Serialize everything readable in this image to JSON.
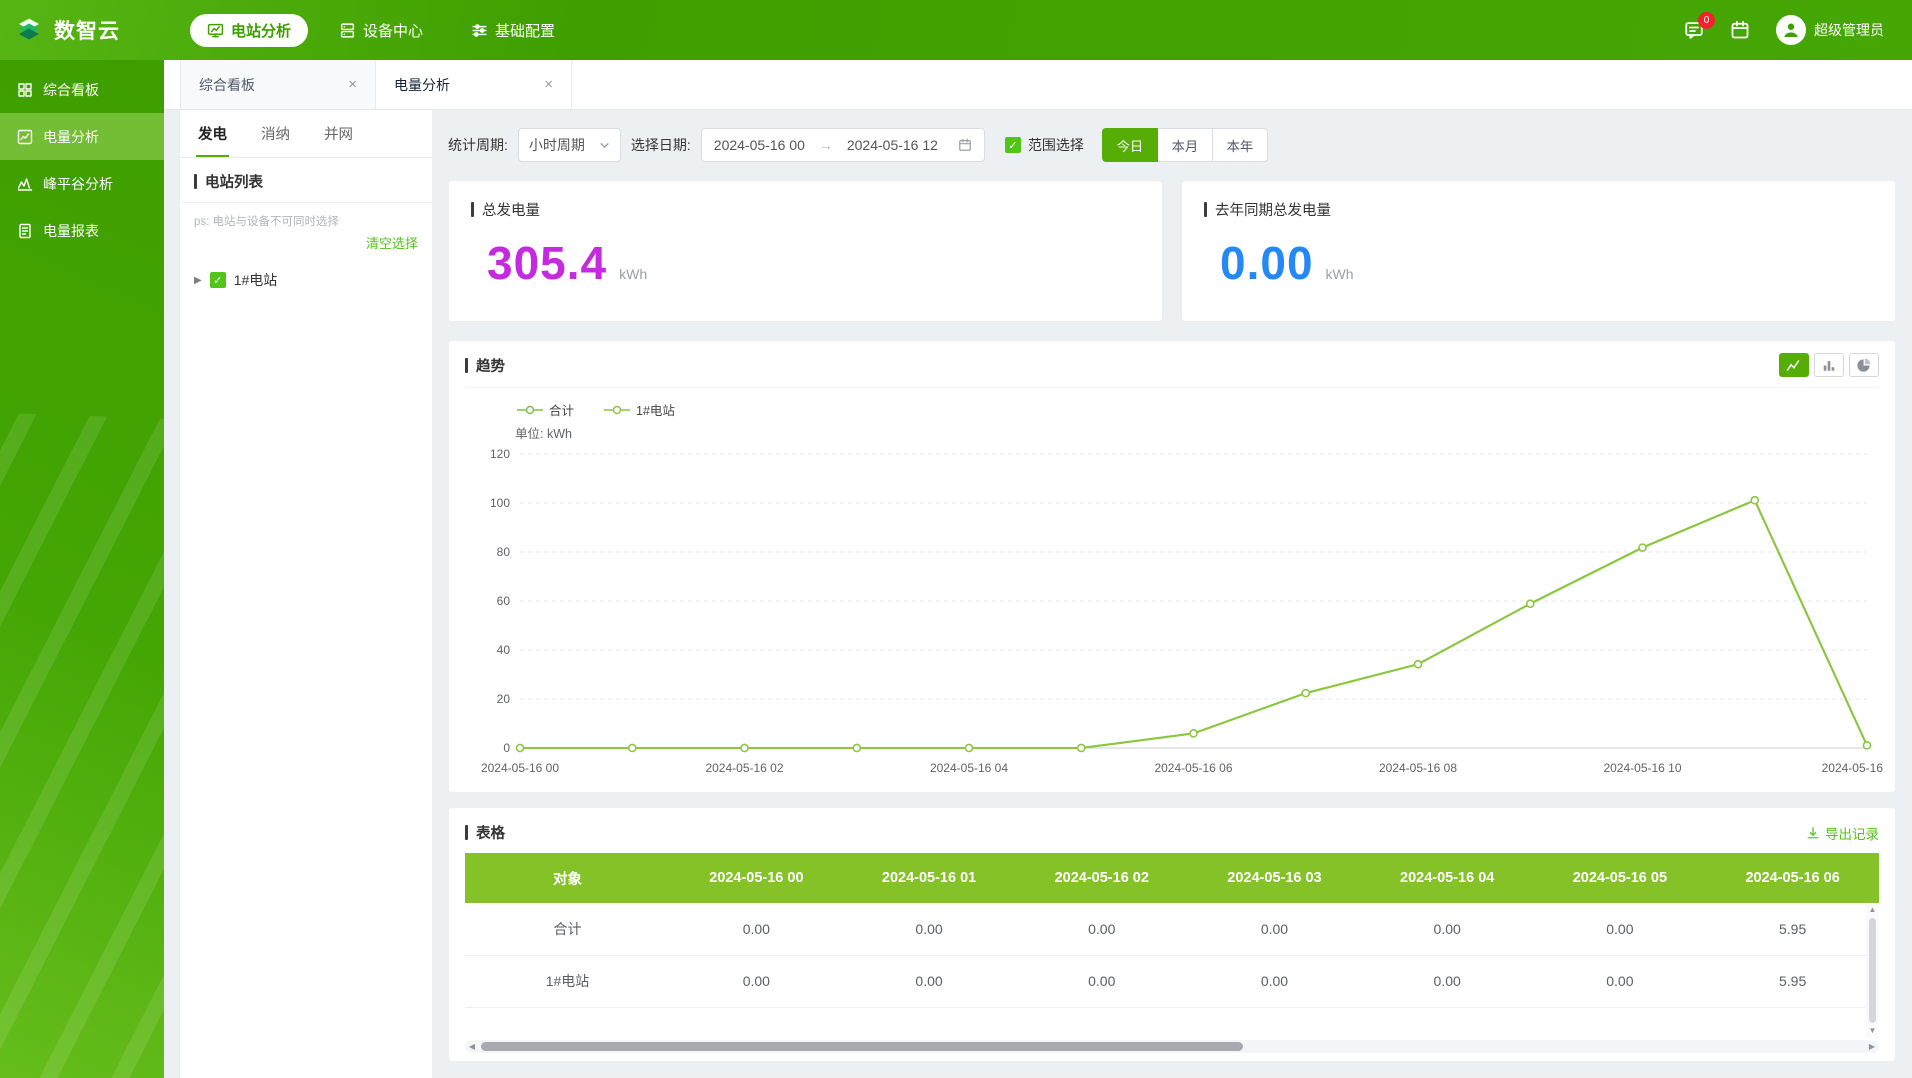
{
  "theme": {
    "brand_green": "#3f9f00",
    "accent_green": "#55ad05",
    "link_green": "#52c41a",
    "table_header_green": "#84c228",
    "sidebar_active_green": "#74be35",
    "badge_red": "#f5222d"
  },
  "app": {
    "logo_text": "数智云",
    "nav": [
      {
        "key": "station-analysis",
        "label": "电站分析",
        "icon": "station-analysis-icon",
        "active": true
      },
      {
        "key": "device-center",
        "label": "设备中心",
        "icon": "device-center-icon",
        "active": false
      },
      {
        "key": "base-config",
        "label": "基础配置",
        "icon": "base-config-icon",
        "active": false
      }
    ],
    "message_badge": "0",
    "user_name": "超级管理员"
  },
  "sidebar": {
    "items": [
      {
        "key": "dashboard",
        "label": "综合看板",
        "icon": "dashboard-icon",
        "active": false
      },
      {
        "key": "energy-analysis",
        "label": "电量分析",
        "icon": "energy-analysis-icon",
        "active": true
      },
      {
        "key": "peak-valley",
        "label": "峰平谷分析",
        "icon": "peak-valley-icon",
        "active": false
      },
      {
        "key": "energy-report",
        "label": "电量报表",
        "icon": "report-icon",
        "active": false
      }
    ]
  },
  "workspace_tabs": [
    {
      "key": "dashboard",
      "label": "综合看板",
      "active": false
    },
    {
      "key": "energy-analysis",
      "label": "电量分析",
      "active": true
    }
  ],
  "station_panel": {
    "tabs": [
      {
        "key": "generation",
        "label": "发电",
        "active": true
      },
      {
        "key": "consumption",
        "label": "消纳",
        "active": false
      },
      {
        "key": "grid",
        "label": "并网",
        "active": false
      }
    ],
    "list_title": "电站列表",
    "hint": "ps: 电站与设备不可同时选择",
    "clear_label": "清空选择",
    "tree": [
      {
        "label": "1#电站",
        "checked": true
      }
    ]
  },
  "filters": {
    "period_label": "统计周期:",
    "period_value": "小时周期",
    "date_label": "选择日期:",
    "date_start": "2024-05-16 00",
    "date_end": "2024-05-16 12",
    "range_label": "范围选择",
    "range_checked": true,
    "quick_ranges": [
      {
        "label": "今日",
        "active": true
      },
      {
        "label": "本月",
        "active": false
      },
      {
        "label": "本年",
        "active": false
      }
    ]
  },
  "stats": [
    {
      "title": "总发电量",
      "value": "305.4",
      "unit": "kWh",
      "color": "#c62ae0"
    },
    {
      "title": "去年同期总发电量",
      "value": "0.00",
      "unit": "kWh",
      "color": "#2589f5"
    }
  ],
  "trend": {
    "title": "趋势",
    "unit_label": "单位: kWh",
    "chart_type_toggles": [
      {
        "key": "line",
        "icon": "line-chart-icon",
        "active": true
      },
      {
        "key": "bar",
        "icon": "bar-chart-icon",
        "active": false
      },
      {
        "key": "pie",
        "icon": "pie-chart-icon",
        "active": false
      }
    ]
  },
  "chart_data": {
    "type": "line",
    "title": "趋势",
    "ylabel": "kWh",
    "x": [
      "2024-05-16 00",
      "2024-05-16 01",
      "2024-05-16 02",
      "2024-05-16 03",
      "2024-05-16 04",
      "2024-05-16 05",
      "2024-05-16 06",
      "2024-05-16 07",
      "2024-05-16 08",
      "2024-05-16 09",
      "2024-05-16 10",
      "2024-05-16 11",
      "2024-05-16 12"
    ],
    "x_tick_indices": [
      0,
      2,
      4,
      6,
      8,
      10,
      12
    ],
    "x_tick_labels": [
      "2024-05-16 00",
      "2024-05-16 02",
      "2024-05-16 04",
      "2024-05-16 06",
      "2024-05-16 08",
      "2024-05-16 10",
      "2024-05-16"
    ],
    "series": [
      {
        "name": "合计",
        "color": "#7fc342",
        "values": [
          0,
          0,
          0,
          0,
          0,
          0,
          5.95,
          22.4,
          34.2,
          58.9,
          81.8,
          101.1,
          1.05
        ]
      },
      {
        "name": "1#电站",
        "color": "#8dc63f",
        "values": [
          0,
          0,
          0,
          0,
          0,
          0,
          5.95,
          22.4,
          34.2,
          58.9,
          81.8,
          101.1,
          1.05
        ]
      }
    ],
    "ylim": [
      0,
      120
    ],
    "y_ticks": [
      0,
      20,
      40,
      60,
      80,
      100,
      120
    ],
    "grid": true,
    "legend_position": "top-left"
  },
  "table": {
    "title": "表格",
    "export_label": "导出记录",
    "columns": [
      "对象",
      "2024-05-16 00",
      "2024-05-16 01",
      "2024-05-16 02",
      "2024-05-16 03",
      "2024-05-16 04",
      "2024-05-16 05",
      "2024-05-16 06"
    ],
    "rows": [
      {
        "name": "合计",
        "values": [
          "0.00",
          "0.00",
          "0.00",
          "0.00",
          "0.00",
          "0.00",
          "5.95"
        ]
      },
      {
        "name": "1#电站",
        "values": [
          "0.00",
          "0.00",
          "0.00",
          "0.00",
          "0.00",
          "0.00",
          "5.95"
        ]
      }
    ]
  }
}
